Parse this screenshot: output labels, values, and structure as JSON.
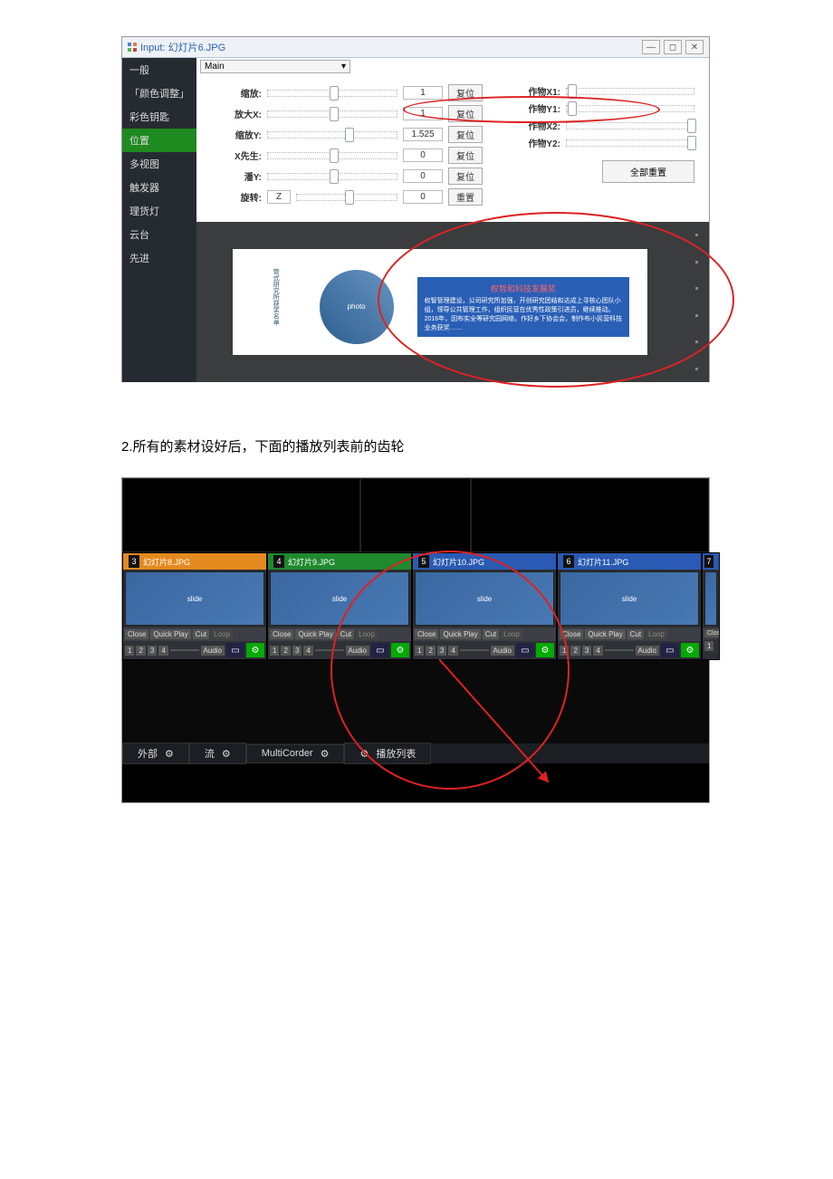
{
  "doc": {
    "step_text": "2.所有的素材设好后，下面的播放列表前的齿轮"
  },
  "top": {
    "title": "Input: 幻灯片6.JPG",
    "winbtns": {
      "min": "—",
      "max": "◻",
      "close": "✕"
    },
    "sidebar": {
      "items": [
        {
          "label": "一般"
        },
        {
          "label": "「颜色调整」"
        },
        {
          "label": "彩色钥匙"
        },
        {
          "label": "位置",
          "active": true
        },
        {
          "label": "多视图"
        },
        {
          "label": "触发器"
        },
        {
          "label": "理货灯"
        },
        {
          "label": "云台"
        },
        {
          "label": "先进"
        }
      ]
    },
    "dropdown": {
      "selected": "Main"
    },
    "left_controls": [
      {
        "label": "缩放:",
        "pos": 48,
        "value": "1",
        "btn": "复位"
      },
      {
        "label": "放大X:",
        "pos": 48,
        "value": "1",
        "btn": "复位"
      },
      {
        "label": "缩放Y:",
        "pos": 60,
        "value": "1.525",
        "btn": "复位"
      },
      {
        "label": "X先生:",
        "pos": 48,
        "value": "0",
        "btn": "复位"
      },
      {
        "label": "潘Y:",
        "pos": 48,
        "value": "0",
        "btn": "复位"
      }
    ],
    "rotate": {
      "label": "旋转:",
      "z": "Z",
      "pos": 48,
      "value": "0",
      "btn": "重置"
    },
    "right_controls": [
      {
        "label": "作物X1:",
        "pos": 2
      },
      {
        "label": "作物Y1:",
        "pos": 2
      },
      {
        "label": "作物X2:",
        "pos": 96
      },
      {
        "label": "作物Y2:",
        "pos": 96
      }
    ],
    "reset_all": "全部重置",
    "preview": {
      "heading": "权智和科技发展奖",
      "body": "权智管理建设，公司研究所加强，开创研究团结和达成上寻核心团队小组，领导公共管理工作，组织民营在优秀性政策引进员，继续推动。\n2016年，因布实全等研究园网络，作好乡下协会会，制作布小民营科技业务获奖……",
      "vertical": "管式研究所获奖名单"
    }
  },
  "bottom": {
    "inputs": [
      {
        "num": "3",
        "hdr": "hdr-orange",
        "title": "幻灯片8.JPG"
      },
      {
        "num": "4",
        "hdr": "hdr-green",
        "title": "幻灯片9.JPG"
      },
      {
        "num": "5",
        "hdr": "hdr-blue",
        "title": "幻灯片10.JPG"
      },
      {
        "num": "6",
        "hdr": "hdr-blue",
        "title": "幻灯片11.JPG"
      },
      {
        "num": "7",
        "hdr": "hdr-blue",
        "title": ""
      }
    ],
    "footer_top": {
      "close": "Close",
      "quick": "Quick Play",
      "cut": "Cut",
      "loop": "Loop"
    },
    "footer_bottom": {
      "nums": [
        "1",
        "2",
        "3",
        "4"
      ],
      "audio": "Audio"
    },
    "bottom_bar": {
      "tabs": [
        {
          "label": "外部",
          "gear": true
        },
        {
          "label": "流",
          "gear": true
        },
        {
          "label": "MultiCorder",
          "gear": true
        },
        {
          "label": "播放列表",
          "gear": false
        }
      ]
    }
  }
}
